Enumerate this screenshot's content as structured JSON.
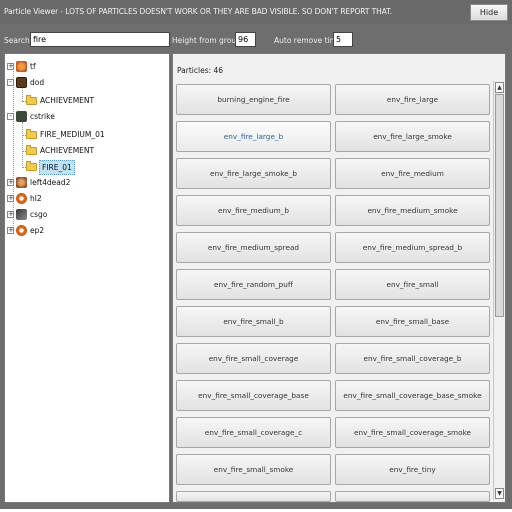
{
  "window": {
    "title": "Particle Viewer - LOTS OF PARTICLES DOESN'T WORK OR THEY ARE BAD VISIBLE. SO DON'T REPORT THAT.",
    "hide_label": "Hide"
  },
  "toolbar": {
    "search_label": "Search:",
    "search_value": "fire",
    "height_label": "Height from ground:",
    "height_value": "96",
    "auto_remove_label": "Auto remove time:",
    "auto_remove_value": "5"
  },
  "tree": {
    "items": [
      {
        "label": "tf",
        "expander": "+",
        "icon": "tf-game-icon"
      },
      {
        "label": "dod",
        "expander": "-",
        "icon": "dod-game-icon"
      },
      {
        "label": "ACHIEVEMENT",
        "icon": "folder-icon"
      },
      {
        "label": "cstrike",
        "expander": "-",
        "icon": "cstrike-game-icon"
      },
      {
        "label": "FIRE_MEDIUM_01",
        "icon": "folder-icon"
      },
      {
        "label": "ACHIEVEMENT",
        "icon": "folder-icon"
      },
      {
        "label": "FIRE_01",
        "icon": "folder-icon",
        "selected": true
      },
      {
        "label": "left4dead2",
        "expander": "+",
        "icon": "l4d2-game-icon"
      },
      {
        "label": "hl2",
        "expander": "+",
        "icon": "hl2-game-icon"
      },
      {
        "label": "csgo",
        "expander": "+",
        "icon": "csgo-game-icon"
      },
      {
        "label": "ep2",
        "expander": "+",
        "icon": "ep2-game-icon"
      }
    ]
  },
  "particles": {
    "count_label": "Particles: 46",
    "buttons": [
      "burning_engine_fire",
      "env_fire_large",
      "env_fire_large_b",
      "env_fire_large_smoke",
      "env_fire_large_smoke_b",
      "env_fire_medium",
      "env_fire_medium_b",
      "env_fire_medium_smoke",
      "env_fire_medium_spread",
      "env_fire_medium_spread_b",
      "env_fire_random_puff",
      "env_fire_small",
      "env_fire_small_b",
      "env_fire_small_base",
      "env_fire_small_coverage",
      "env_fire_small_coverage_b",
      "env_fire_small_coverage_base",
      "env_fire_small_coverage_base_smoke",
      "env_fire_small_coverage_c",
      "env_fire_small_coverage_smoke",
      "env_fire_small_smoke",
      "env_fire_tiny"
    ]
  },
  "colors": {
    "window_bg": "#6e6e6e",
    "selected_button_text": "#2a5fa6",
    "tree_selection": "#bfe2f7"
  }
}
